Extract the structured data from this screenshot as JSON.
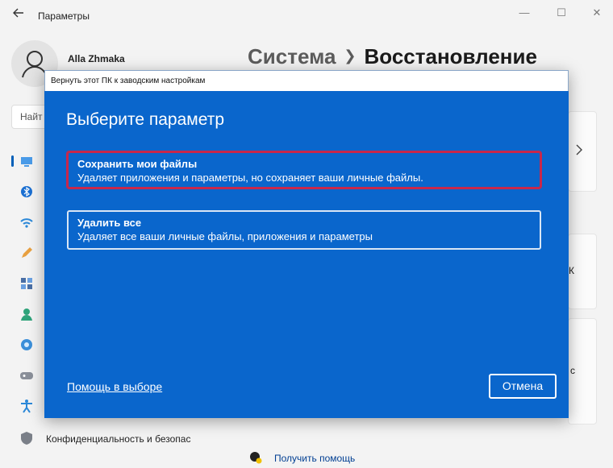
{
  "window": {
    "title": "Параметры",
    "back_icon": "back-arrow-icon",
    "minimize": "—",
    "maximize": "☐",
    "close": "✕"
  },
  "sidebar": {
    "user_name": "Alla Zhmaka",
    "search_text": "Найт",
    "icons": [
      "display-icon",
      "bluetooth-icon",
      "wifi-icon",
      "pen-icon",
      "apps-icon",
      "accounts-icon",
      "time-language-icon",
      "gaming-icon",
      "accessibility-icon",
      "shield-icon"
    ],
    "privacy_label": "Конфиденциальность и безопас"
  },
  "main": {
    "crumb_parent": "Система",
    "crumb_current": "Восстановление",
    "get_help": "Получить помощь",
    "card_fragment_1": "К",
    "card_fragment_2": "с"
  },
  "dialog": {
    "title": "Вернуть этот ПК к заводским настройкам",
    "heading": "Выберите параметр",
    "options": [
      {
        "title": "Сохранить мои файлы",
        "desc": "Удаляет приложения и параметры, но сохраняет ваши личные файлы."
      },
      {
        "title": "Удалить все",
        "desc": "Удаляет все ваши личные файлы, приложения и параметры"
      }
    ],
    "help_link": "Помощь в выборе",
    "cancel": "Отмена"
  },
  "colors": {
    "dialog_bg": "#0a66cc",
    "selected_border": "#c8274b",
    "accent": "#005fb8"
  }
}
